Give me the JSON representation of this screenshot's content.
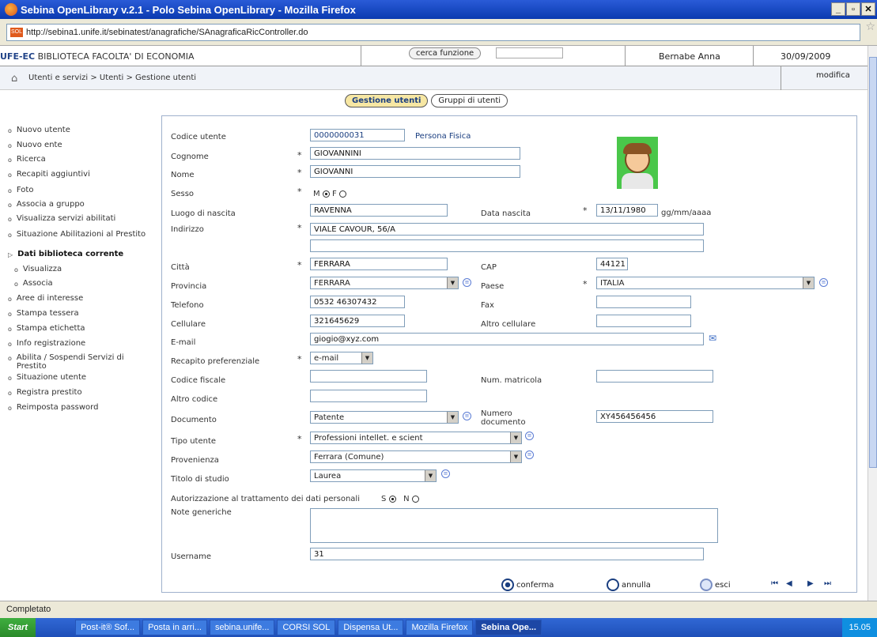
{
  "window": {
    "title": "Sebina OpenLibrary v.2.1 - Polo Sebina OpenLibrary - Mozilla Firefox"
  },
  "browser": {
    "url": "http://sebina1.unife.it/sebinatest/anagrafiche/SAnagraficaRicController.do",
    "status": "Completato"
  },
  "header": {
    "library_code": "UFE-EC",
    "library_name": "BIBLIOTECA FACOLTA' DI ECONOMIA",
    "search_function": "cerca funzione",
    "user": "Bernabe Anna",
    "date": "30/09/2009"
  },
  "breadcrumb": {
    "path": "Utenti e servizi > Utenti > Gestione utenti",
    "mode": "modifica"
  },
  "tabs": [
    {
      "label": "Gestione utenti"
    },
    {
      "label": "Gruppi di utenti"
    }
  ],
  "menu": [
    {
      "label": "Nuovo utente"
    },
    {
      "label": "Nuovo ente"
    },
    {
      "label": "Ricerca"
    },
    {
      "label": "Recapiti aggiuntivi"
    },
    {
      "label": "Foto"
    },
    {
      "label": "Associa a gruppo"
    },
    {
      "label": "Visualizza servizi abilitati"
    },
    {
      "label": "Situazione Abilitazioni al Prestito"
    },
    {
      "label": "Dati biblioteca corrente"
    },
    {
      "label": "Visualizza"
    },
    {
      "label": "Associa"
    },
    {
      "label": "Aree di interesse"
    },
    {
      "label": "Stampa tessera"
    },
    {
      "label": "Stampa etichetta"
    },
    {
      "label": "Info registrazione"
    },
    {
      "label": "Abilita / Sospendi Servizi di Prestito"
    },
    {
      "label": "Situazione utente"
    },
    {
      "label": "Registra prestito"
    },
    {
      "label": "Reimposta password"
    }
  ],
  "form": {
    "codice_utente": {
      "label": "Codice utente",
      "value": "0000000031",
      "tipo": "Persona Fisica"
    },
    "cognome": {
      "label": "Cognome",
      "value": "GIOVANNINI"
    },
    "nome": {
      "label": "Nome",
      "value": "GIOVANNI"
    },
    "sesso": {
      "label": "Sesso",
      "m": "M",
      "f": "F"
    },
    "luogo_nascita": {
      "label": "Luogo di nascita",
      "value": "RAVENNA"
    },
    "data_nascita": {
      "label": "Data nascita",
      "value": "13/11/1980",
      "hint": "gg/mm/aaaa"
    },
    "indirizzo": {
      "label": "Indirizzo",
      "value": "VIALE CAVOUR, 56/A",
      "value2": ""
    },
    "citta": {
      "label": "Città",
      "value": "FERRARA"
    },
    "cap": {
      "label": "CAP",
      "value": "44121"
    },
    "provincia": {
      "label": "Provincia",
      "value": "FERRARA"
    },
    "paese": {
      "label": "Paese",
      "value": "ITALIA"
    },
    "telefono": {
      "label": "Telefono",
      "value": "0532 46307432"
    },
    "fax": {
      "label": "Fax",
      "value": ""
    },
    "cellulare": {
      "label": "Cellulare",
      "value": "321645629"
    },
    "altro_cellulare": {
      "label": "Altro cellulare",
      "value": ""
    },
    "email": {
      "label": "E-mail",
      "value": "giogio@xyz.com"
    },
    "recapito": {
      "label": "Recapito preferenziale",
      "value": "e-mail"
    },
    "codice_fiscale": {
      "label": "Codice fiscale",
      "value": ""
    },
    "matricola": {
      "label": "Num. matricola",
      "value": ""
    },
    "altro_codice": {
      "label": "Altro codice",
      "value": ""
    },
    "documento": {
      "label": "Documento",
      "value": "Patente"
    },
    "numero_documento": {
      "label": "Numero documento",
      "value": "XY456456456"
    },
    "tipo_utente": {
      "label": "Tipo utente",
      "value": "Professioni intellet. e scient"
    },
    "provenienza": {
      "label": "Provenienza",
      "value": "Ferrara (Comune)"
    },
    "titolo_studio": {
      "label": "Titolo di studio",
      "value": "Laurea"
    },
    "autorizzazione": {
      "label": "Autorizzazione al trattamento dei dati personali",
      "s": "S",
      "n": "N"
    },
    "note": {
      "label": "Note generiche",
      "value": ""
    },
    "username": {
      "label": "Username",
      "value": "31"
    }
  },
  "footer": {
    "conferma": "conferma",
    "annulla": "annulla",
    "esci": "esci"
  },
  "taskbar": {
    "start": "Start",
    "items": [
      "Post-it® Sof...",
      "Posta in arri...",
      "sebina.unife...",
      "CORSI SOL",
      "Dispensa Ut...",
      "Mozilla Firefox",
      "Sebina Ope..."
    ],
    "clock": "15.05"
  }
}
